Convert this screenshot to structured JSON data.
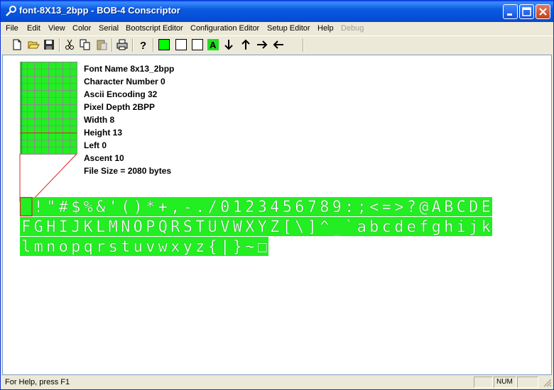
{
  "window": {
    "title": "font-8X13_2bpp - BOB-4 Conscriptor"
  },
  "menu": [
    "File",
    "Edit",
    "View",
    "Color",
    "Serial",
    "Bootscript Editor",
    "Configuration Editor",
    "Setup Editor",
    "Help",
    "Debug"
  ],
  "toolbar": {
    "buttons": [
      "new-icon",
      "open-icon",
      "save-icon",
      "cut-icon",
      "copy-icon",
      "paste-icon",
      "print-icon",
      "help-icon",
      "green-color-icon",
      "white-color-icon",
      "white-color-icon",
      "text-a-icon",
      "arrow-down-icon",
      "arrow-up-icon",
      "arrow-right-icon",
      "arrow-left-icon"
    ],
    "a_label": "A"
  },
  "font_info": {
    "name": "Font Name 8x13_2bpp",
    "char_number": "Character Number 0",
    "ascii": "Ascii Encoding 32",
    "depth": "Pixel Depth 2BPP",
    "width": "Width 8",
    "height": "Height 13",
    "left": "Left 0",
    "ascent": "Ascent 10",
    "file_size": "File Size = 2080 bytes"
  },
  "glyph_rows": [
    " !\"#$%&'()*+,-./0123456789:;<=>?@ABCDE",
    "FGHIJKLMNOPQRSTUVWXYZ[\\]^_`abcdefghijk",
    "lmnopqrstuvwxyz{|}~□"
  ],
  "colors": {
    "glyph_bg": "#22ee22",
    "selection": "#dd2222",
    "grid_line": "#8c8c8c",
    "baseline": "#e02020"
  },
  "status": {
    "help": "For Help, press F1",
    "num": "NUM"
  }
}
